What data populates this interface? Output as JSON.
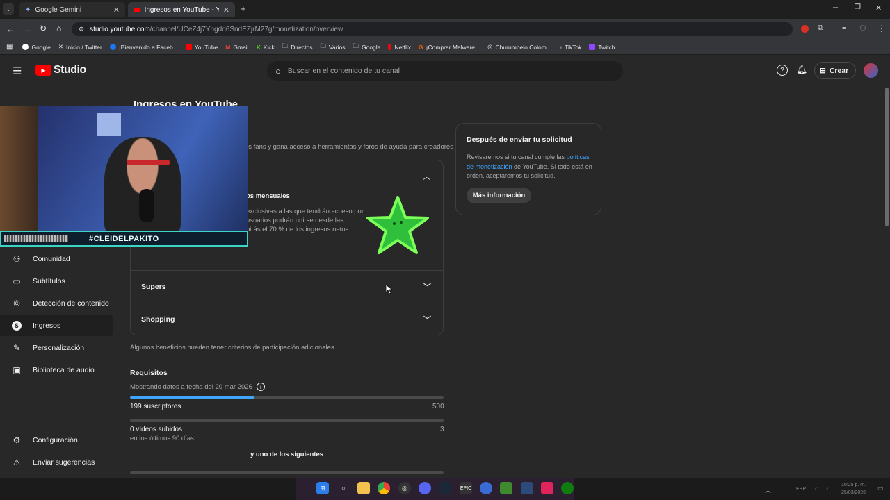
{
  "browser": {
    "tabs": [
      {
        "label": "Google Gemini",
        "active": false
      },
      {
        "label": "Ingresos en YouTube - YouTube",
        "active": true
      }
    ],
    "url_host": "studio.youtube.com",
    "url_path": "/channel/UCeZ4j7Yhgdd6SndEZjrM27g/monetization/overview",
    "bookmarks": [
      "Google",
      "Inicio / Twitter",
      "¡Bienvenido a Faceb...",
      "YouTube",
      "Gmail",
      "Kick",
      "Directos",
      "Varios",
      "Google",
      "Netflix",
      "¡Comprar Malware...",
      "Churumbelo Colom...",
      "TikTok",
      "Twitch"
    ]
  },
  "studio": {
    "logo_text": "Studio",
    "search_placeholder": "Buscar en el contenido de tu canal",
    "create_label": "Crear"
  },
  "sidebar": {
    "items": [
      {
        "label": "Comunidad",
        "icon": "community-icon"
      },
      {
        "label": "Subtítulos",
        "icon": "subtitles-icon"
      },
      {
        "label": "Detección de contenido",
        "icon": "copyright-icon"
      },
      {
        "label": "Ingresos",
        "icon": "dollar-icon",
        "active": true
      },
      {
        "label": "Personalización",
        "icon": "magic-wand-icon"
      },
      {
        "label": "Biblioteca de audio",
        "icon": "audio-library-icon"
      }
    ],
    "settings_label": "Configuración",
    "feedback_label": "Enviar sugerencias"
  },
  "main": {
    "page_title": "Ingresos en YouTube",
    "intro_text": "us fans y gana acceso a herramientas y foros de ayuda para creadores",
    "membership_title": "os mensuales",
    "membership_lines": [
      "exclusivas a las que tendrán acceso por",
      "usuarios podrán unirse desde las",
      "birás el 70 % de los ingresos netos."
    ],
    "accordion": [
      {
        "label": "Supers"
      },
      {
        "label": "Shopping"
      }
    ],
    "benefits_note": "Algunos beneficios pueden tener criterios de participación adicionales.",
    "requirements_title": "Requisitos",
    "data_date": "Mostrando datos a fecha del 20 mar 2026",
    "subscribers_label": "199 suscriptores",
    "subscribers_current": 199,
    "subscribers_target_label": "500",
    "subscribers_progress": 0.398,
    "videos_label": "0 vídeos subidos",
    "videos_sub": "en los últimos 90 días",
    "videos_target_label": "3",
    "videos_progress": 0,
    "or_text": "y uno de los siguientes"
  },
  "side_card": {
    "title": "Después de enviar tu solicitud",
    "text_before": "Revisaremos si tu canal cumple las",
    "link": "políticas de monetización",
    "text_after": " de YouTube. Si todo está en orden, aceptaremos tu solicitud.",
    "button": "Más información"
  },
  "overlay": {
    "hashtag": "#CLEIDELPAKITO"
  },
  "taskbar": {
    "lang": "ESP",
    "time": "10:25 p. m.",
    "date": "25/03/2026"
  },
  "colors": {
    "accent_blue": "#3ea6ff",
    "progress_fill": "#3ea6ff",
    "yt_red": "#ff0000",
    "overlay_teal": "#3dd6c4"
  }
}
